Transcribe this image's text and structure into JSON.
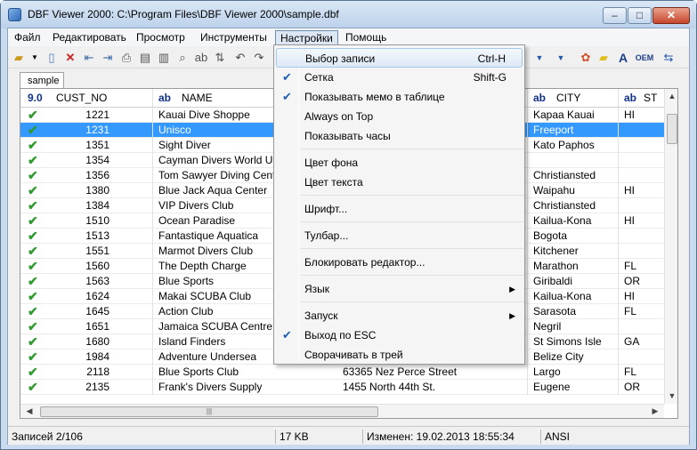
{
  "window": {
    "title": "DBF Viewer 2000: C:\\Program Files\\DBF Viewer 2000\\sample.dbf"
  },
  "menubar": [
    "Файл",
    "Редактировать",
    "Просмотр",
    "Инструменты",
    "Настройки",
    "Помощь"
  ],
  "tab": "sample",
  "columns": {
    "type_num": "9.0",
    "no": "CUST_NO",
    "type_text": "ab",
    "name": "NAME",
    "city": "CITY",
    "state": "ST"
  },
  "rows": [
    {
      "no": "1221",
      "name": "Kauai Dive Shoppe",
      "addr": "",
      "city": "Kapaa Kauai",
      "st": "HI"
    },
    {
      "no": "1231",
      "name": "Unisco",
      "addr": "",
      "city": "Freeport",
      "st": ""
    },
    {
      "no": "1351",
      "name": "Sight Diver",
      "addr": "",
      "city": "Kato Paphos",
      "st": ""
    },
    {
      "no": "1354",
      "name": "Cayman Divers World Unlimited",
      "addr": "",
      "city": "",
      "st": ""
    },
    {
      "no": "1356",
      "name": "Tom Sawyer Diving Centre",
      "addr": "",
      "city": "Christiansted",
      "st": ""
    },
    {
      "no": "1380",
      "name": "Blue Jack Aqua Center",
      "addr": "",
      "city": "Waipahu",
      "st": "HI"
    },
    {
      "no": "1384",
      "name": "VIP Divers Club",
      "addr": "",
      "city": "Christiansted",
      "st": ""
    },
    {
      "no": "1510",
      "name": "Ocean Paradise",
      "addr": "",
      "city": "Kailua-Kona",
      "st": "HI"
    },
    {
      "no": "1513",
      "name": "Fantastique Aquatica",
      "addr": "",
      "city": "Bogota",
      "st": ""
    },
    {
      "no": "1551",
      "name": "Marmot Divers Club",
      "addr": "",
      "city": "Kitchener",
      "st": ""
    },
    {
      "no": "1560",
      "name": "The Depth Charge",
      "addr": "",
      "city": "Marathon",
      "st": "FL"
    },
    {
      "no": "1563",
      "name": "Blue Sports",
      "addr": "",
      "city": "Giribaldi",
      "st": "OR"
    },
    {
      "no": "1624",
      "name": "Makai SCUBA Club",
      "addr": "",
      "city": "Kailua-Kona",
      "st": "HI"
    },
    {
      "no": "1645",
      "name": "Action Club",
      "addr": "",
      "city": "Sarasota",
      "st": "FL"
    },
    {
      "no": "1651",
      "name": "Jamaica SCUBA Centre",
      "addr": "",
      "city": "Negril",
      "st": ""
    },
    {
      "no": "1680",
      "name": "Island Finders",
      "addr": "",
      "city": "St Simons Isle",
      "st": "GA"
    },
    {
      "no": "1984",
      "name": "Adventure Undersea",
      "addr": "",
      "city": "Belize City",
      "st": ""
    },
    {
      "no": "2118",
      "name": "Blue Sports Club",
      "addr": "63365 Nez Perce Street",
      "city": "Largo",
      "st": "FL"
    },
    {
      "no": "2135",
      "name": "Frank's Divers Supply",
      "addr": "1455 North 44th St.",
      "city": "Eugene",
      "st": "OR"
    }
  ],
  "selected_row_index": 1,
  "dropdown": [
    {
      "type": "item",
      "label": "Выбор записи",
      "shortcut": "Ctrl-H",
      "checked": false,
      "highlight": true
    },
    {
      "type": "item",
      "label": "Сетка",
      "shortcut": "Shift-G",
      "checked": true
    },
    {
      "type": "item",
      "label": "Показывать мемо в таблице",
      "checked": true
    },
    {
      "type": "item",
      "label": "Always on Top",
      "checked": false
    },
    {
      "type": "item",
      "label": "Показывать часы",
      "checked": false
    },
    {
      "type": "sep"
    },
    {
      "type": "item",
      "label": "Цвет фона",
      "checked": false
    },
    {
      "type": "item",
      "label": "Цвет текста",
      "checked": false
    },
    {
      "type": "sep"
    },
    {
      "type": "item",
      "label": "Шрифт...",
      "checked": false
    },
    {
      "type": "sep"
    },
    {
      "type": "item",
      "label": "Тулбар...",
      "checked": false
    },
    {
      "type": "sep"
    },
    {
      "type": "item",
      "label": "Блокировать редактор...",
      "checked": false
    },
    {
      "type": "sep"
    },
    {
      "type": "item",
      "label": "Язык",
      "submenu": true,
      "checked": false
    },
    {
      "type": "sep"
    },
    {
      "type": "item",
      "label": "Запуск",
      "submenu": true,
      "checked": false
    },
    {
      "type": "item",
      "label": "Выход по ESC",
      "checked": true
    },
    {
      "type": "item",
      "label": "Сворачивать в трей",
      "checked": false
    }
  ],
  "status": {
    "records": "Записей 2/106",
    "size": "17 KB",
    "modified": "Изменен: 19.02.2013 18:55:34",
    "encoding": "ANSI"
  },
  "toolbar_right": {
    "oem_label": "OEM"
  },
  "colors": {
    "selection": "#3399ff",
    "check": "#2f9a2f",
    "menu_highlight": "#dde9f6"
  }
}
